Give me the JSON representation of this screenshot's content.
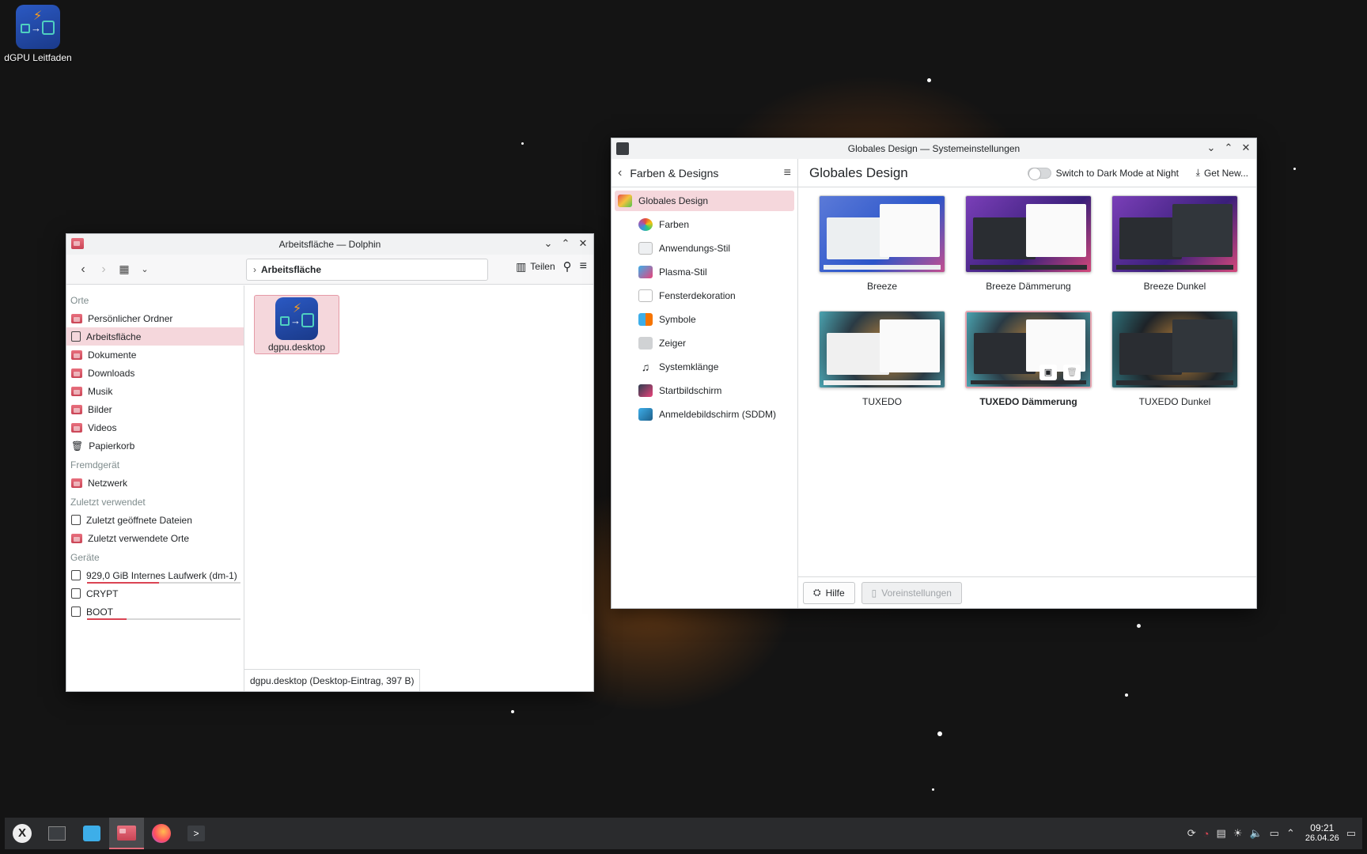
{
  "desktop": {
    "icon_label": "dGPU Leitfaden"
  },
  "dolphin": {
    "title": "Arbeitsfläche — Dolphin",
    "breadcrumb": "Arbeitsfläche",
    "share_label": "Teilen",
    "sections": {
      "places": "Orte",
      "remote": "Fremdgerät",
      "recent": "Zuletzt verwendet",
      "devices": "Geräte"
    },
    "places": [
      "Persönlicher Ordner",
      "Arbeitsfläche",
      "Dokumente",
      "Downloads",
      "Musik",
      "Bilder",
      "Videos",
      "Papierkorb"
    ],
    "remote": [
      "Netzwerk"
    ],
    "recent": [
      "Zuletzt geöffnete Dateien",
      "Zuletzt verwendete Orte"
    ],
    "devices": [
      {
        "label": "929,0 GiB Internes Laufwerk (dm-1)",
        "usage": 0.47
      },
      {
        "label": "CRYPT"
      },
      {
        "label": "BOOT",
        "usage": 0.26
      }
    ],
    "file_name": "dgpu.desktop",
    "status": "dgpu.desktop (Desktop-Eintrag, 397 B)"
  },
  "settings": {
    "title": "Globales Design — Systemeinstellungen",
    "section_title": "Farben & Designs",
    "page_title": "Globales Design",
    "night_label": "Switch to Dark Mode at Night",
    "get_new_label": "Get New...",
    "categories": [
      "Globales Design",
      "Farben",
      "Anwendungs-Stil",
      "Plasma-Stil",
      "Fensterdekoration",
      "Symbole",
      "Zeiger",
      "Systemklänge",
      "Startbildschirm",
      "Anmeldebildschirm (SDDM)"
    ],
    "themes": [
      "Breeze",
      "Breeze Dämmerung",
      "Breeze Dunkel",
      "TUXEDO",
      "TUXEDO Dämmerung",
      "TUXEDO Dunkel"
    ],
    "help_label": "Hilfe",
    "defaults_label": "Voreinstellungen"
  },
  "taskbar": {
    "time": "09:21",
    "date": "26.04.26"
  },
  "colors": {
    "accent": "#da4453",
    "highlight": "#f5d7dc"
  }
}
